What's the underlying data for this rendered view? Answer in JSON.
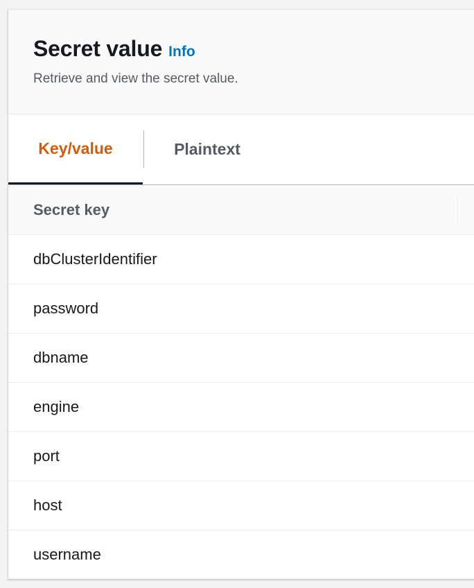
{
  "panel": {
    "title": "Secret value",
    "info_link": "Info",
    "description": "Retrieve and view the secret value."
  },
  "tabs": [
    {
      "label": "Key/value",
      "active": true
    },
    {
      "label": "Plaintext",
      "active": false
    }
  ],
  "table": {
    "columns": [
      "Secret key"
    ],
    "rows": [
      {
        "key": "dbClusterIdentifier"
      },
      {
        "key": "password"
      },
      {
        "key": "dbname"
      },
      {
        "key": "engine"
      },
      {
        "key": "port"
      },
      {
        "key": "host"
      },
      {
        "key": "username"
      }
    ]
  },
  "colors": {
    "active_tab": "#d45b07",
    "link": "#0073bb",
    "text": "#16191f",
    "muted": "#545b64"
  }
}
